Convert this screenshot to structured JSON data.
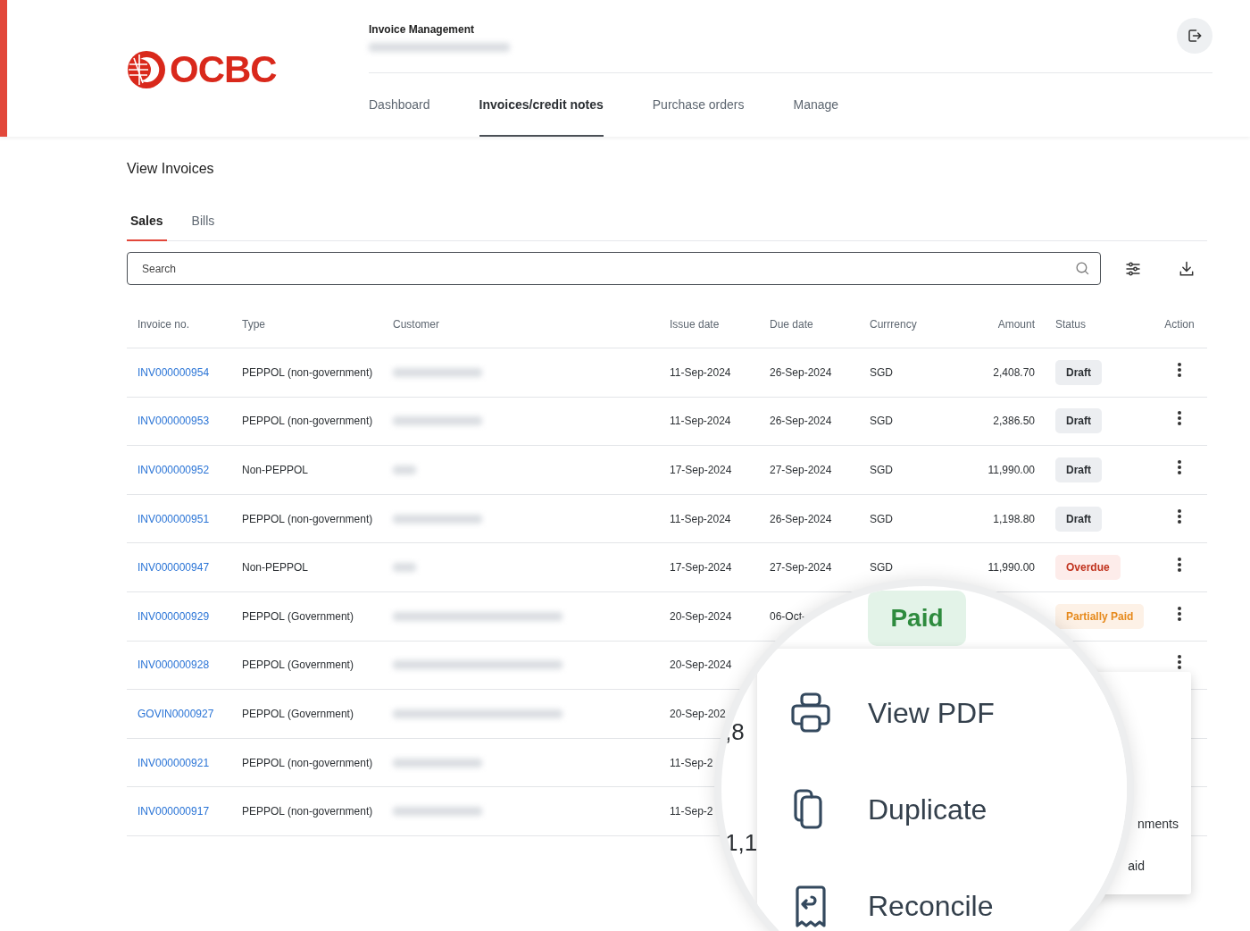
{
  "brand": "OCBC",
  "header": {
    "title": "Invoice Management",
    "subtitle_blurred": true
  },
  "nav": [
    {
      "label": "Dashboard",
      "selected": false
    },
    {
      "label": "Invoices/credit notes",
      "selected": true
    },
    {
      "label": "Purchase orders",
      "selected": false
    },
    {
      "label": "Manage",
      "selected": false
    }
  ],
  "page_title": "View Invoices",
  "subtabs": [
    {
      "label": "Sales",
      "selected": true
    },
    {
      "label": "Bills",
      "selected": false
    }
  ],
  "search": {
    "placeholder": "Search"
  },
  "table": {
    "columns": [
      "Invoice no.",
      "Type",
      "Customer",
      "Issue date",
      "Due date",
      "Currrency",
      "Amount",
      "Status",
      "Action"
    ],
    "rows": [
      {
        "invoice": "INV000000954",
        "type": "PEPPOL (non-government)",
        "customer_blurred": true,
        "issue": "11-Sep-2024",
        "due": "26-Sep-2024",
        "currency": "SGD",
        "amount": "2,408.70",
        "status": {
          "label": "Draft",
          "kind": "draft"
        },
        "menu": true
      },
      {
        "invoice": "INV000000953",
        "type": "PEPPOL (non-government)",
        "customer_blurred": true,
        "issue": "11-Sep-2024",
        "due": "26-Sep-2024",
        "currency": "SGD",
        "amount": "2,386.50",
        "status": {
          "label": "Draft",
          "kind": "draft"
        },
        "menu": true
      },
      {
        "invoice": "INV000000952",
        "type": "Non-PEPPOL",
        "customer_blurred": true,
        "issue": "17-Sep-2024",
        "due": "27-Sep-2024",
        "currency": "SGD",
        "amount": "11,990.00",
        "status": {
          "label": "Draft",
          "kind": "draft"
        },
        "menu": true
      },
      {
        "invoice": "INV000000951",
        "type": "PEPPOL (non-government)",
        "customer_blurred": true,
        "issue": "11-Sep-2024",
        "due": "26-Sep-2024",
        "currency": "SGD",
        "amount": "1,198.80",
        "status": {
          "label": "Draft",
          "kind": "draft"
        },
        "menu": true
      },
      {
        "invoice": "INV000000947",
        "type": "Non-PEPPOL",
        "customer_blurred": true,
        "issue": "17-Sep-2024",
        "due": "27-Sep-2024",
        "currency": "SGD",
        "amount": "11,990.00",
        "status": {
          "label": "Overdue",
          "kind": "overdue"
        },
        "menu": true
      },
      {
        "invoice": "INV000000929",
        "type": "PEPPOL (Government)",
        "customer_blurred": true,
        "issue": "20-Sep-2024",
        "due": "06-Oct-",
        "status": {
          "label": "Partially Paid",
          "kind": "partial"
        },
        "menu": true
      },
      {
        "invoice": "INV000000928",
        "type": "PEPPOL (Government)",
        "customer_blurred": true,
        "issue": "20-Sep-2024",
        "menu": true
      },
      {
        "invoice": "GOVIN0000927",
        "type": "PEPPOL (Government)",
        "customer_blurred": true,
        "issue": "20-Sep-202"
      },
      {
        "invoice": "INV000000921",
        "type": "PEPPOL (non-government)",
        "customer_blurred": true,
        "issue": "11-Sep-2"
      },
      {
        "invoice": "INV000000917",
        "type": "PEPPOL (non-government)",
        "customer_blurred": true,
        "issue": "11-Sep-2"
      }
    ]
  },
  "background_menu": [
    "nments",
    "aid"
  ],
  "magnifier": {
    "badge": {
      "label": "Paid",
      "kind": "paid"
    },
    "fragments": [
      ",8",
      "1,1"
    ],
    "menu_items": [
      {
        "label": "View PDF",
        "kind": "print"
      },
      {
        "label": "Duplicate",
        "kind": "duplicate"
      },
      {
        "label": "Reconcile",
        "kind": "reconcile"
      }
    ]
  }
}
